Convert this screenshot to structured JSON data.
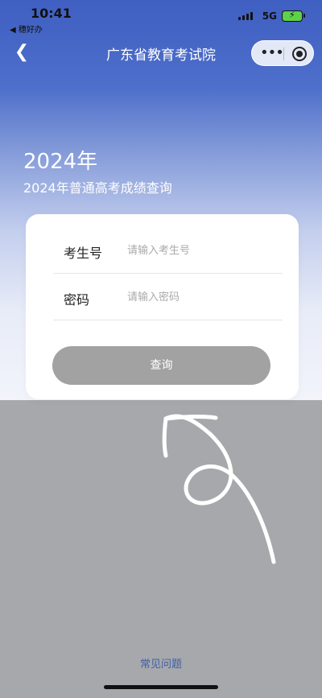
{
  "status_bar": {
    "time": "10:41",
    "back_app": "◀ 穗好办",
    "network": "5G",
    "battery_icon": "battery-charging-icon"
  },
  "navbar": {
    "back_icon": "chevron-left-icon",
    "title": "广东省教育考试院",
    "more_icon": "more-dots-icon",
    "close_icon": "target-circle-icon"
  },
  "hero": {
    "year": "2024年",
    "subtitle": "2024年普通高考成绩查询"
  },
  "form": {
    "exam_no_label": "考生号",
    "exam_no_placeholder": "请输入考生号",
    "password_label": "密码",
    "password_placeholder": "请输入密码",
    "submit_label": "查询"
  },
  "footer": {
    "faq_link": "常见问题"
  },
  "colors": {
    "hero_top": "#3f5fc2",
    "button": "#a2a2a2",
    "page_bg": "#a7a8ab",
    "link": "#3f5ea8"
  }
}
